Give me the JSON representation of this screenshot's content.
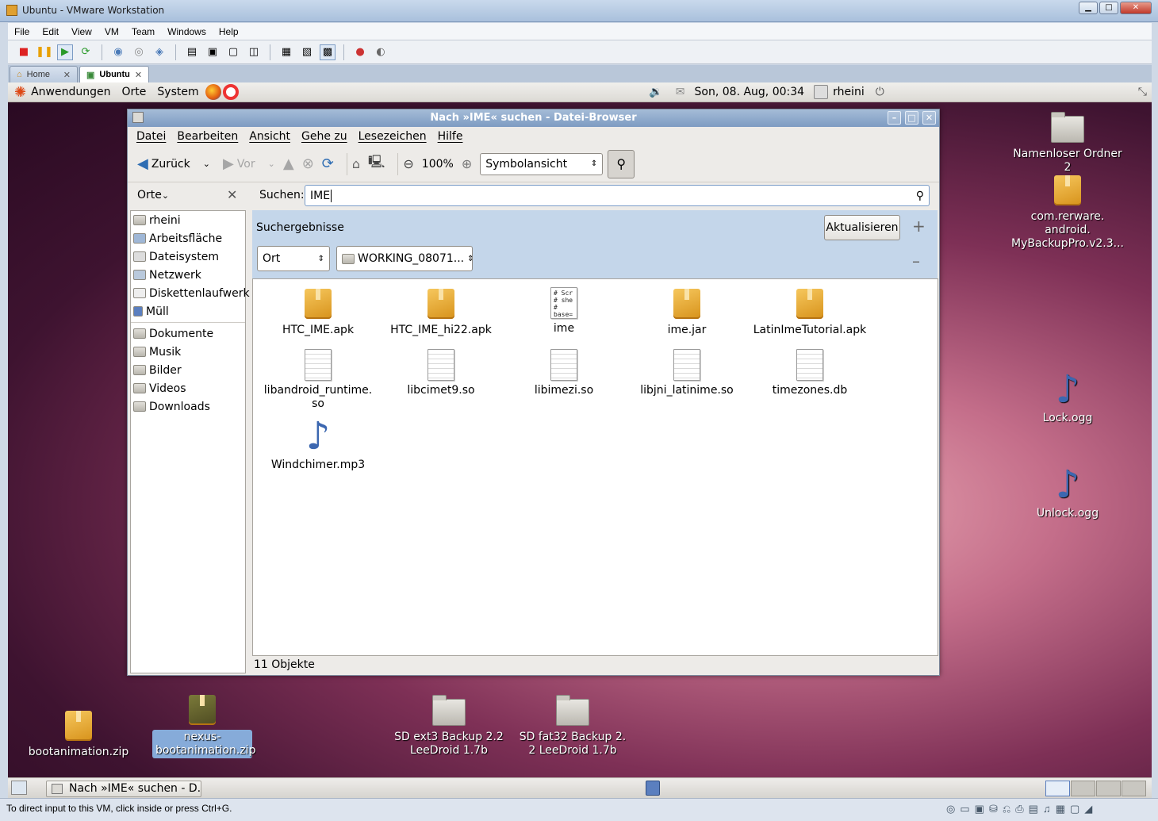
{
  "host": {
    "title": "Ubuntu - VMware Workstation",
    "menu": [
      "File",
      "Edit",
      "View",
      "VM",
      "Team",
      "Windows",
      "Help"
    ],
    "tabs": [
      {
        "label": "Home",
        "active": false
      },
      {
        "label": "Ubuntu",
        "active": true
      }
    ],
    "status_text": "To direct input to this VM, click inside or press Ctrl+G."
  },
  "gnome": {
    "menus": [
      "Anwendungen",
      "Orte",
      "System"
    ],
    "clock": "Son, 08. Aug, 00:34",
    "user": "rheini"
  },
  "filebrowser": {
    "title": "Nach »IME« suchen - Datei-Browser",
    "menu": [
      "Datei",
      "Bearbeiten",
      "Ansicht",
      "Gehe zu",
      "Lesezeichen",
      "Hilfe"
    ],
    "toolbar": {
      "back": "Zurück",
      "forward": "Vor",
      "zoom": "100%",
      "view_mode": "Symbolansicht"
    },
    "sidebar": {
      "title": "Orte",
      "places": [
        "rheini",
        "Arbeitsfläche",
        "Dateisystem",
        "Netzwerk",
        "Diskettenlaufwerk",
        "Müll"
      ],
      "bookmarks": [
        "Dokumente",
        "Musik",
        "Bilder",
        "Videos",
        "Downloads"
      ]
    },
    "search": {
      "label": "Suchen:",
      "query": "IME"
    },
    "results": {
      "title": "Suchergebnisse",
      "refresh": "Aktualisieren",
      "filter_type": "Ort",
      "filter_value": "WORKING_08071..."
    },
    "files": [
      {
        "name": "HTC_IME.apk",
        "type": "package"
      },
      {
        "name": "HTC_IME_hi22.apk",
        "type": "package"
      },
      {
        "name": "ime",
        "type": "script",
        "preview": "# Scr\n# she\n#\nbase="
      },
      {
        "name": "ime.jar",
        "type": "package"
      },
      {
        "name": "LatinImeTutorial.apk",
        "type": "package"
      },
      {
        "name": "libandroid_runtime.\nso",
        "type": "document"
      },
      {
        "name": "libcimet9.so",
        "type": "document"
      },
      {
        "name": "libimezi.so",
        "type": "document"
      },
      {
        "name": "libjni_latinime.so",
        "type": "document"
      },
      {
        "name": "timezones.db",
        "type": "document"
      },
      {
        "name": "Windchimer.mp3",
        "type": "audio"
      }
    ],
    "status": "11 Objekte"
  },
  "desktop_icons": [
    {
      "name": "Namenloser Ordner\n2",
      "type": "folder"
    },
    {
      "name": "com.rerware.\nandroid.\nMyBackupPro.v2.3...",
      "type": "package"
    },
    {
      "name": "Lock.ogg",
      "type": "audio"
    },
    {
      "name": "Unlock.ogg",
      "type": "audio"
    },
    {
      "name": "bootanimation.zip",
      "type": "package"
    },
    {
      "name": "nexus-\nbootanimation.zip",
      "type": "package",
      "selected": true
    },
    {
      "name": "SD ext3 Backup 2.2\nLeeDroid 1.7b",
      "type": "folder"
    },
    {
      "name": "SD fat32 Backup 2.\n2 LeeDroid 1.7b",
      "type": "folder"
    }
  ],
  "taskbar": {
    "window_button": "Nach »IME« suchen - D..."
  }
}
